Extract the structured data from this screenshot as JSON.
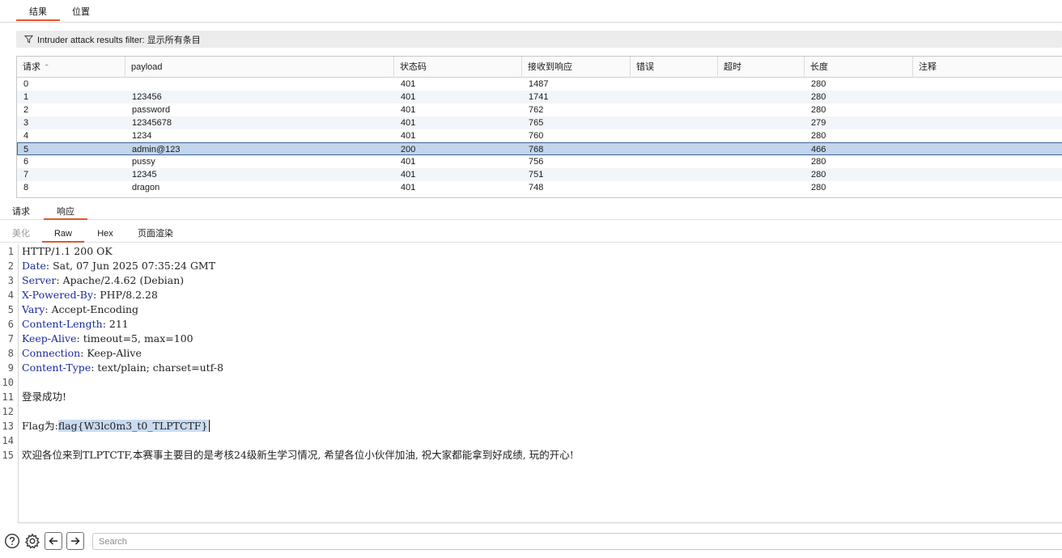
{
  "top_tabs": [
    "结果",
    "位置"
  ],
  "filter": {
    "label": "Intruder attack results filter: 显示所有条目",
    "icon": "funnel-icon"
  },
  "table": {
    "columns": [
      "请求",
      "payload",
      "状态码",
      "接收到响应",
      "错误",
      "超时",
      "长度",
      "注释"
    ],
    "sort_column": "请求",
    "sort_direction": "ascending",
    "rows": [
      [
        "0",
        "",
        "401",
        "1487",
        "",
        "",
        "280",
        ""
      ],
      [
        "1",
        "123456",
        "401",
        "1741",
        "",
        "",
        "280",
        ""
      ],
      [
        "2",
        "password",
        "401",
        "762",
        "",
        "",
        "280",
        ""
      ],
      [
        "3",
        "12345678",
        "401",
        "765",
        "",
        "",
        "279",
        ""
      ],
      [
        "4",
        "1234",
        "401",
        "760",
        "",
        "",
        "280",
        ""
      ],
      [
        "5",
        "admin@123",
        "200",
        "768",
        "",
        "",
        "466",
        ""
      ],
      [
        "6",
        "pussy",
        "401",
        "756",
        "",
        "",
        "280",
        ""
      ],
      [
        "7",
        "12345",
        "401",
        "751",
        "",
        "",
        "280",
        ""
      ],
      [
        "8",
        "dragon",
        "401",
        "748",
        "",
        "",
        "280",
        ""
      ]
    ],
    "selected_row": 5,
    "selection_color": "#c3d5ec"
  },
  "request_tabs": [
    "请求",
    "响应"
  ],
  "active_request_tab": "响应",
  "view_tabs": [
    "美化",
    "Raw",
    "Hex",
    "页面渲染"
  ],
  "active_view_tab": "Raw",
  "response": {
    "status_line": "HTTP/1.1 200 OK",
    "headers": [
      {
        "name": "Date",
        "value": " Sat, 07 Jun 2025 07:35:24 GMT"
      },
      {
        "name": "Server",
        "value": " Apache/2.4.62 (Debian)"
      },
      {
        "name": "X-Powered-By",
        "value": " PHP/8.2.28"
      },
      {
        "name": "Vary",
        "value": " Accept-Encoding"
      },
      {
        "name": "Content-Length",
        "value": " 211"
      },
      {
        "name": "Keep-Alive",
        "value": " timeout=5, max=100"
      },
      {
        "name": "Connection",
        "value": " Keep-Alive"
      },
      {
        "name": "Content-Type",
        "value": " text/plain; charset=utf-8"
      }
    ],
    "line11": "登录成功!",
    "line13_prefix": "Flag为:",
    "line13_flag": "flag{W3lc0m3_t0_TLPTCTF}",
    "line15": "欢迎各位来到TLPTCTF,本赛事主要目的是考核24级新生学习情况, 希望各位小伙伴加油, 祝大家都能拿到好成绩, 玩的开心!",
    "line_numbers": [
      "1",
      "2",
      "3",
      "4",
      "5",
      "6",
      "7",
      "8",
      "9",
      "10",
      "11",
      "12",
      "13",
      "14",
      "15"
    ],
    "header_name_color": "#1a2a9b"
  },
  "bottom": {
    "search_placeholder": "Search",
    "icons": [
      "help-icon",
      "settings-icon",
      "back-arrow-icon",
      "forward-arrow-icon"
    ]
  },
  "accent_color": "#e1582a"
}
